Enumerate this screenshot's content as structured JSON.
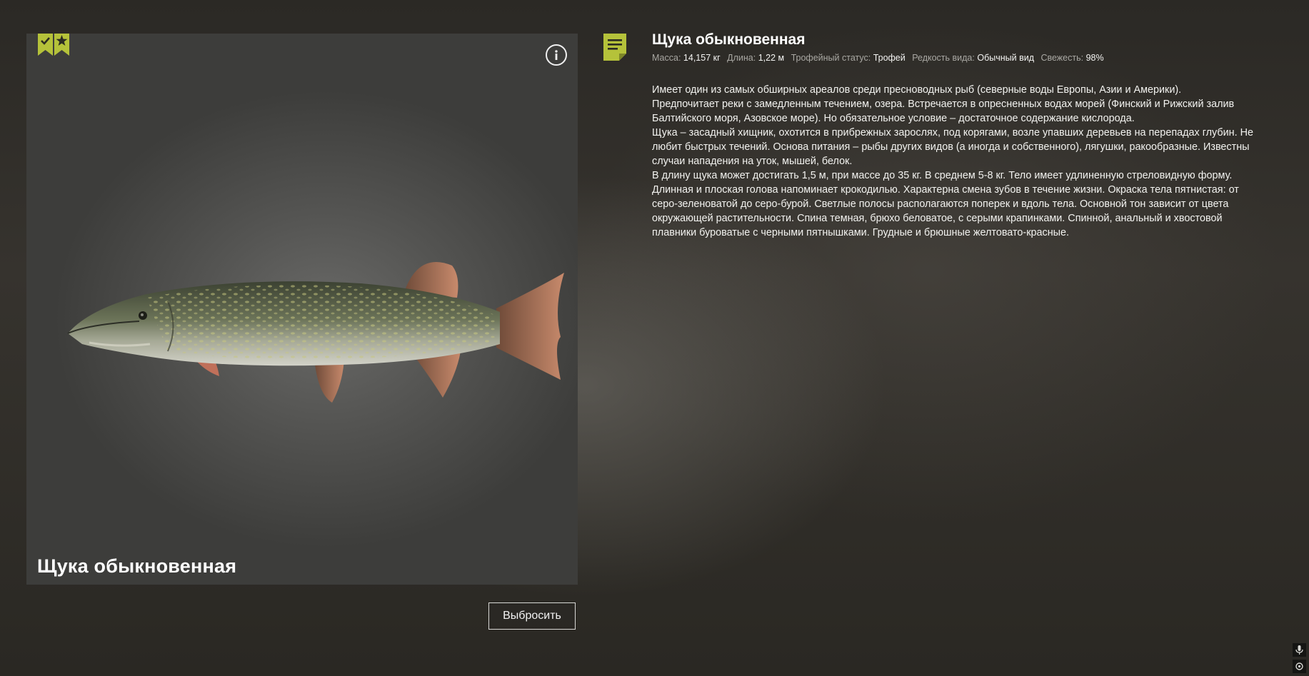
{
  "colors": {
    "accent": "#b5c23a",
    "text": "#f2f2ef",
    "muted": "#a9a8a3"
  },
  "badges": [
    {
      "icon": "checkmark-bookmark-icon"
    },
    {
      "icon": "star-bookmark-icon"
    }
  ],
  "fish_panel": {
    "caption": "Щука обыкновенная",
    "info_icon": "info-icon"
  },
  "discard_label": "Выбросить",
  "detail": {
    "icon": "notes-icon",
    "title": "Щука обыкновенная",
    "stats": [
      {
        "label": "Масса:",
        "value": "14,157 кг"
      },
      {
        "label": "Длина:",
        "value": "1,22 м"
      },
      {
        "label": "Трофейный статус:",
        "value": "Трофей"
      },
      {
        "label": "Редкость вида:",
        "value": "Обычный вид"
      },
      {
        "label": "Свежесть:",
        "value": "98%"
      }
    ],
    "description": [
      "Имеет один из самых обширных ареалов среди пресноводных рыб (северные воды Европы, Азии и Америки).",
      "Предпочитает реки с замедленным течением, озера. Встречается в опресненных водах морей (Финский и Рижский залив Балтийского моря, Азовское море). Но обязательное условие – достаточное содержание кислорода.",
      "Щука – засадный хищник, охотится в прибрежных зарослях, под корягами, возле упавших деревьев на перепадах глубин. Не любит быстрых течений. Основа питания – рыбы других видов (а иногда и собственного), лягушки, ракообразные. Известны случаи нападения на уток, мышей, белок.",
      "В длину щука может достигать 1,5 м, при массе до 35 кг. В среднем 5-8 кг. Тело имеет удлиненную стреловидную форму. Длинная и плоская голова напоминает крокодилью. Характерна смена зубов в течение жизни. Окраска тела пятнистая: от серо-зеленоватой до серо-бурой. Светлые полосы располагаются поперек и вдоль тела. Основной тон зависит от цвета окружающей растительности. Спина темная, брюхо беловатое, с серыми крапинками. Спинной, анальный и хвостовой плавники буроватые с черными пятнышками. Грудные и брюшные желтовато-красные."
    ]
  },
  "corner_icons": [
    "microphone-icon",
    "settings-icon"
  ]
}
